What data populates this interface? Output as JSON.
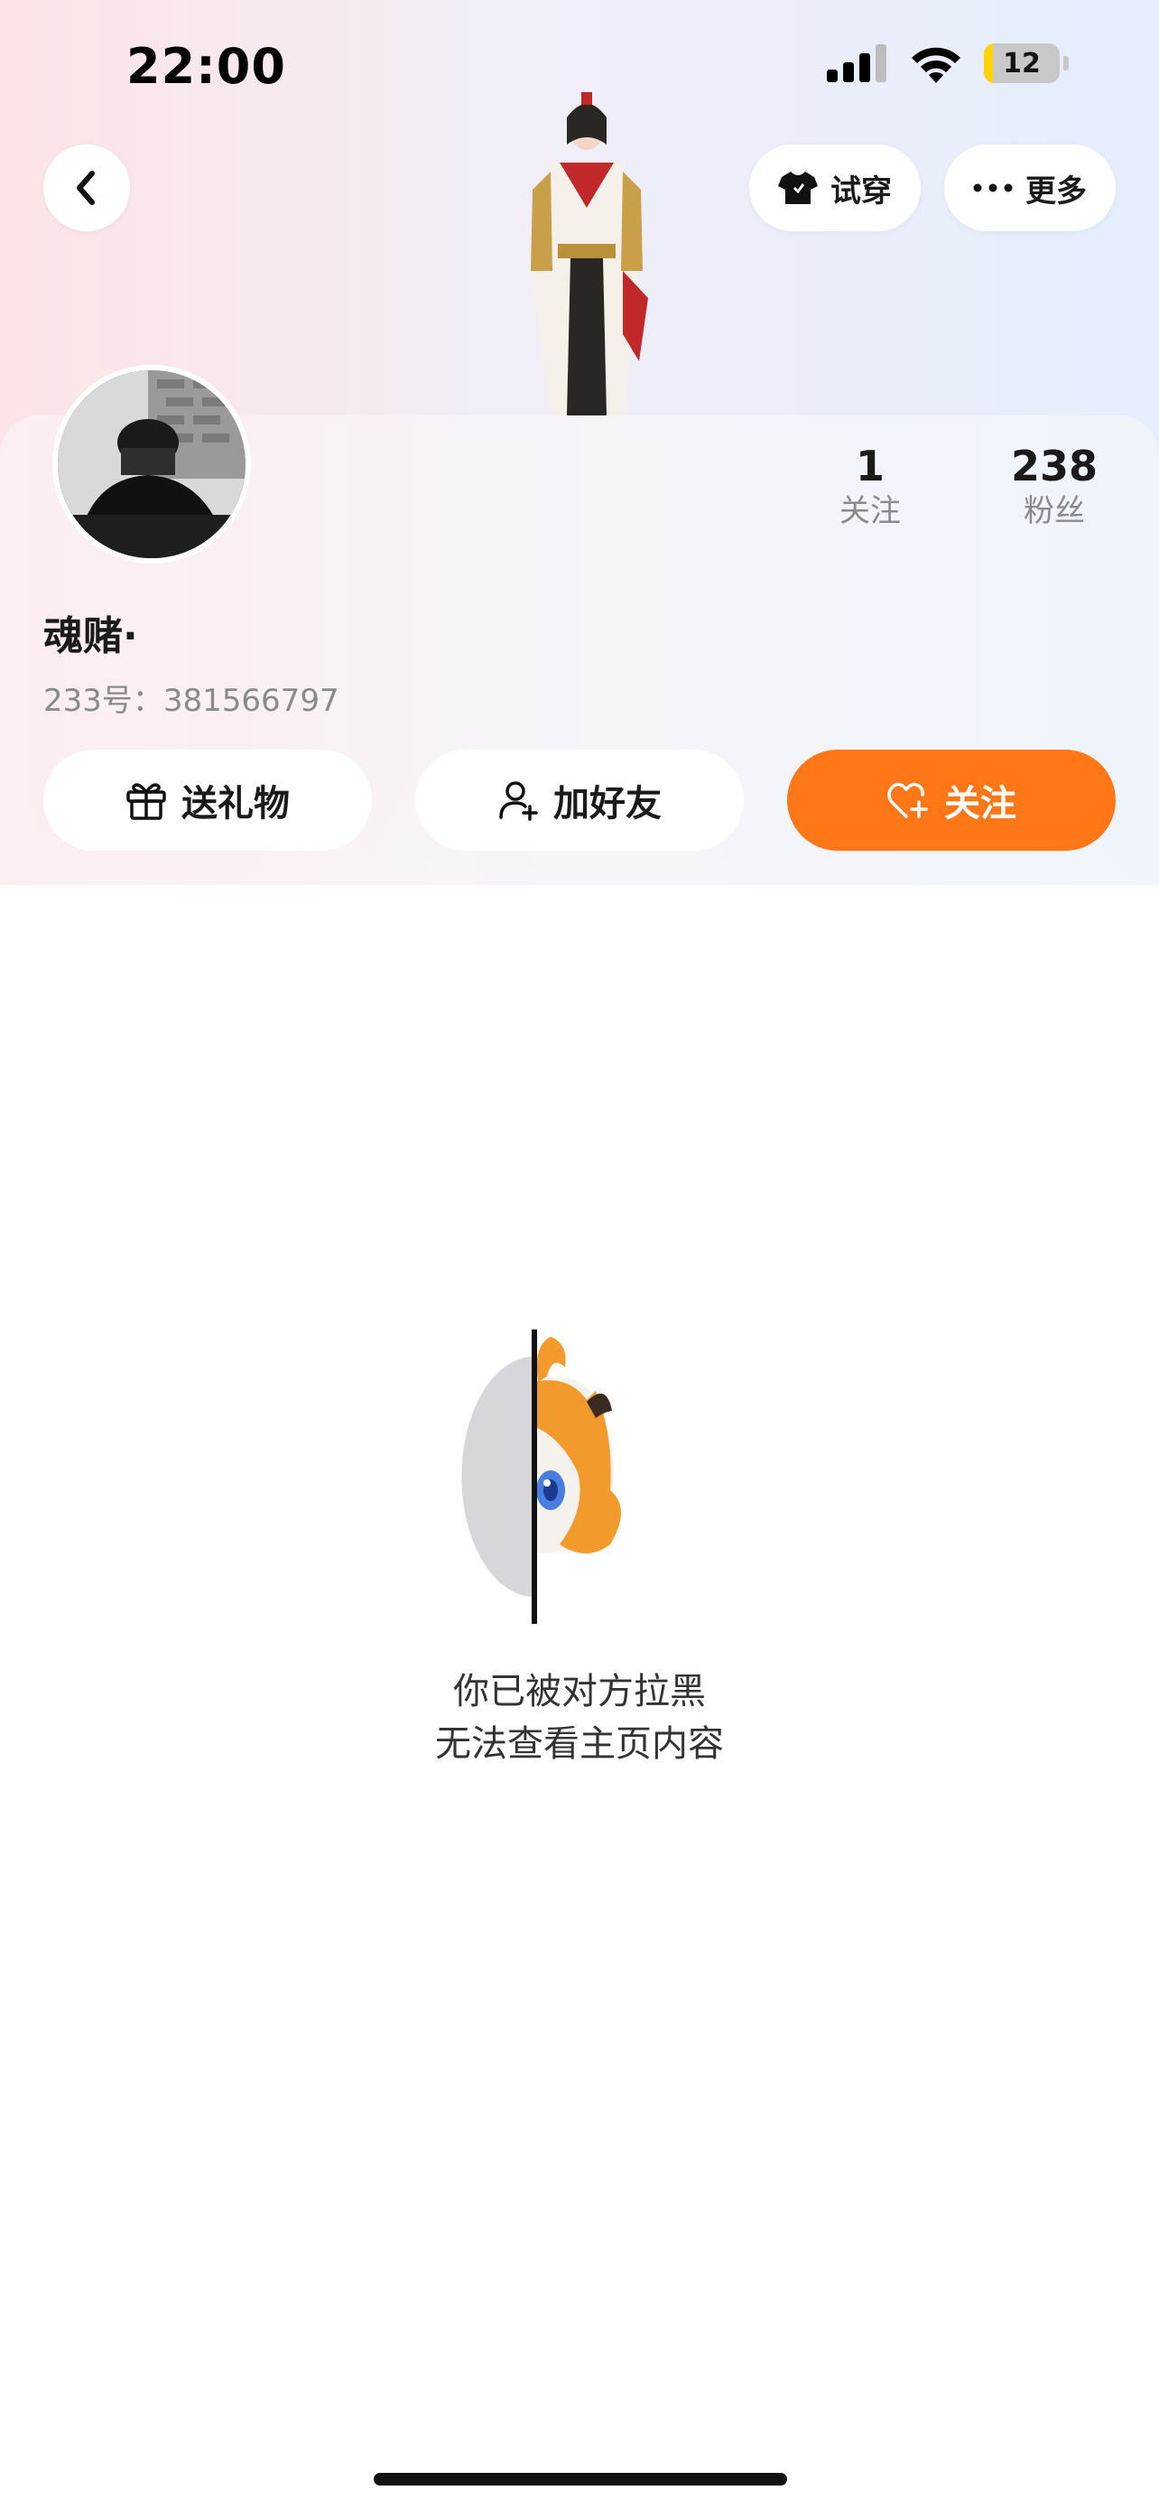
{
  "status_bar": {
    "time": "22:00",
    "battery": "12",
    "battery_level_percent": 12
  },
  "header": {
    "back_icon": "chevron-left-icon",
    "try_on_label": "试穿",
    "try_on_icon": "tshirt-icon",
    "more_label": "更多",
    "more_icon": "ellipsis-icon"
  },
  "profile": {
    "username": "魂赌·",
    "uid_text": "233号：381566797",
    "following_count": "1",
    "following_label": "关注",
    "fans_count": "238",
    "fans_label": "粉丝"
  },
  "actions": {
    "gift_label": "送礼物",
    "gift_icon": "gift-icon",
    "add_friend_label": "加好友",
    "add_friend_icon": "add-user-icon",
    "follow_label": "关注",
    "follow_icon": "heart-plus-icon"
  },
  "empty_state": {
    "line1": "你已被对方拉黑",
    "line2": "无法查看主页内容"
  },
  "colors": {
    "accent": "#ff7716",
    "text_primary": "#1a1a1a",
    "text_secondary": "#8a8a8a"
  }
}
